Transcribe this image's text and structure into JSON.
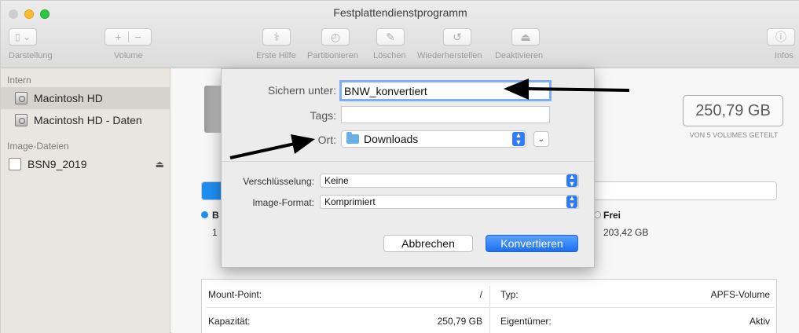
{
  "window": {
    "title": "Festplattendienstprogramm"
  },
  "toolbar": {
    "view_label": "Darstellung",
    "volume_label": "Volume",
    "first_aid_label": "Erste Hilfe",
    "partition_label": "Partitionieren",
    "erase_label": "Löschen",
    "restore_label": "Wiederherstellen",
    "deactivate_label": "Deaktivieren",
    "info_label": "Infos"
  },
  "sidebar": {
    "section_internal": "Intern",
    "section_images": "Image-Dateien",
    "items": [
      {
        "label": "Macintosh HD",
        "selected": true
      },
      {
        "label": "Macintosh HD - Daten",
        "selected": false
      },
      {
        "label": "BSN9_2019",
        "selected": false
      }
    ]
  },
  "main": {
    "capacity": "250,79 GB",
    "capacity_sub": "VON 5 VOLUMES GETEILT",
    "used_label_partial": "B",
    "used_value_partial": "1",
    "used_fraction": 0.14,
    "free_label": "Frei",
    "free_value": "203,42 GB",
    "info": {
      "mount_point_label": "Mount-Point:",
      "mount_point_value": "/",
      "capacity_label": "Kapazität:",
      "capacity_value": "250,79 GB",
      "type_label": "Typ:",
      "type_value": "APFS-Volume",
      "owner_label": "Eigentümer:",
      "owner_value": "Aktiv"
    }
  },
  "dialog": {
    "save_as_label": "Sichern unter:",
    "save_as_value": "BNW_konvertiert",
    "tags_label": "Tags:",
    "tags_value": "",
    "location_label": "Ort:",
    "location_value": "Downloads",
    "encryption_label": "Verschlüsselung:",
    "encryption_value": "Keine",
    "image_format_label": "Image-Format:",
    "image_format_value": "Komprimiert",
    "cancel_label": "Abbrechen",
    "convert_label": "Konvertieren"
  },
  "colors": {
    "accent": "#1f8ef1",
    "primary_button": "#1d6ff2"
  }
}
